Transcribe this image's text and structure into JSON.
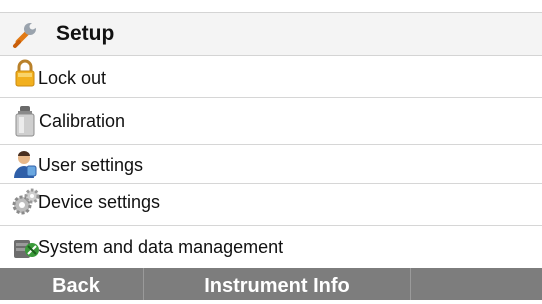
{
  "header": {
    "title": "Setup",
    "icon": "wrench-icon"
  },
  "menu": {
    "items": [
      {
        "label": "Lock out",
        "icon": "padlock-icon"
      },
      {
        "label": "Calibration",
        "icon": "calibration-weight-icon"
      },
      {
        "label": "User settings",
        "icon": "user-icon"
      },
      {
        "label": "Device settings",
        "icon": "gears-icon"
      },
      {
        "label": "System and data management",
        "icon": "data-management-icon"
      }
    ]
  },
  "footer": {
    "back_label": "Back",
    "instrument_info_label": "Instrument Info",
    "empty_label": ""
  },
  "colors": {
    "header_bg": "#f4f4f4",
    "footer_bg": "#7d7d7d",
    "separator": "#d6d6d6"
  }
}
